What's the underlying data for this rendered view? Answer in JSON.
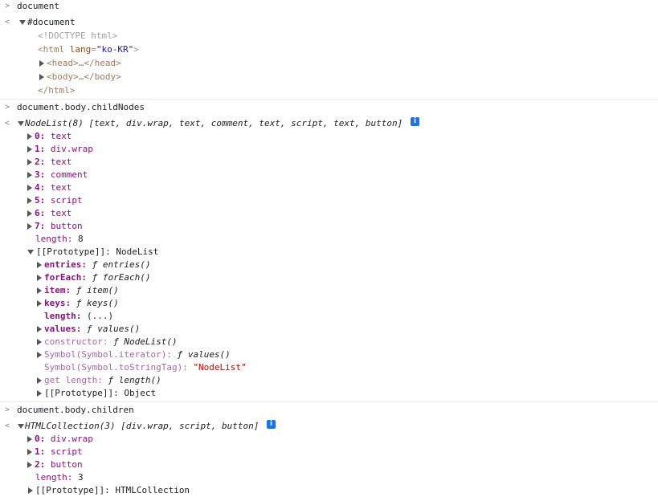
{
  "prompt_glyph": ">",
  "result_glyph": "<",
  "doc_cmd": "document",
  "doc_result": "#document",
  "doctype": "<!DOCTYPE html>",
  "html_open_tag": "html",
  "html_lang_attr": "lang",
  "html_lang_val": "\"ko-KR\"",
  "head_tag": "<head>…</head>",
  "body_tag": "<body>…</body>",
  "html_close": "</html>",
  "childnodes_cmd": "document.body.childNodes",
  "nodelist_summary": "NodeList(8) [text, div.wrap, text, comment, text, script, text, button]",
  "info_glyph": "i",
  "nodes": [
    {
      "k": "0:",
      "v": "text"
    },
    {
      "k": "1:",
      "v": "div.wrap"
    },
    {
      "k": "2:",
      "v": "text"
    },
    {
      "k": "3:",
      "v": "comment"
    },
    {
      "k": "4:",
      "v": "text"
    },
    {
      "k": "5:",
      "v": "script"
    },
    {
      "k": "6:",
      "v": "text"
    },
    {
      "k": "7:",
      "v": "button"
    }
  ],
  "length_key": "length:",
  "length_val_8": "8",
  "proto_key": "[[Prototype]]:",
  "proto_nodelist": "NodeList",
  "proto_items": [
    {
      "k": "entries:",
      "v": "ƒ entries()"
    },
    {
      "k": "forEach:",
      "v": "ƒ forEach()"
    },
    {
      "k": "item:",
      "v": "ƒ item()"
    },
    {
      "k": "keys:",
      "v": "ƒ keys()"
    },
    {
      "k": "length:",
      "v": "(...)"
    },
    {
      "k": "values:",
      "v": "ƒ values()"
    },
    {
      "k": "constructor:",
      "v": "ƒ NodeList()"
    },
    {
      "k": "Symbol(Symbol.iterator):",
      "v": "ƒ values()"
    },
    {
      "k": "Symbol(Symbol.toStringTag):",
      "v": "\"NodeList\""
    },
    {
      "k": "get length:",
      "v": "ƒ length()"
    },
    {
      "k": "[[Prototype]]:",
      "v": "Object"
    }
  ],
  "children_cmd": "document.body.children",
  "htmlcoll_summary": "HTMLCollection(3) [div.wrap, script, button]",
  "children": [
    {
      "k": "0:",
      "v": "div.wrap"
    },
    {
      "k": "1:",
      "v": "script"
    },
    {
      "k": "2:",
      "v": "button"
    }
  ],
  "length_val_3": "3",
  "proto_htmlcoll": "HTMLCollection"
}
